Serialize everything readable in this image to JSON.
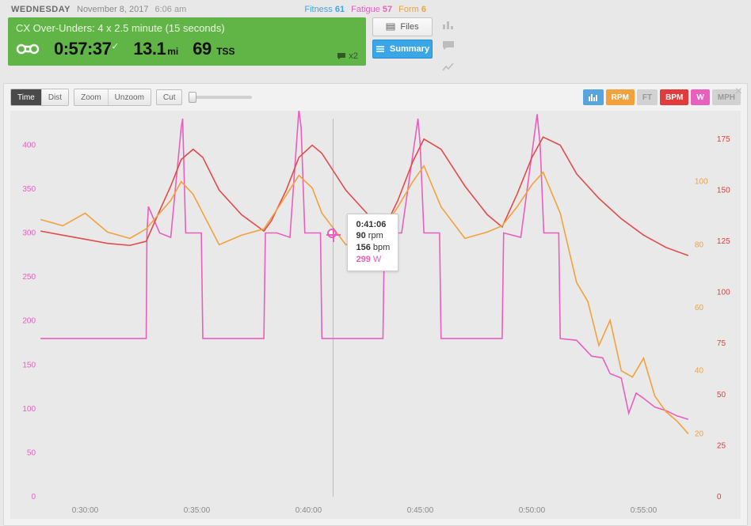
{
  "header": {
    "dow": "WEDNESDAY",
    "date": "November 8, 2017",
    "time": "6:06 am",
    "fitness_label": "Fitness",
    "fitness_value": "61",
    "fatigue_label": "Fatigue",
    "fatigue_value": "57",
    "form_label": "Form",
    "form_value": "6"
  },
  "workout": {
    "title": "CX Over-Unders: 4 x 2.5 minute (15 seconds)",
    "duration": "0:57:37",
    "distance_value": "13.1",
    "distance_unit": "mi",
    "tss_value": "69",
    "tss_label": "TSS",
    "comments_count": "x2"
  },
  "side": {
    "files": "Files",
    "summary": "Summary"
  },
  "toolbar": {
    "time": "Time",
    "dist": "Dist",
    "zoom": "Zoom",
    "unzoom": "Unzoom",
    "cut": "Cut"
  },
  "metrics": {
    "rpm": "RPM",
    "ft": "FT",
    "bpm": "BPM",
    "w": "W",
    "mph": "MPH"
  },
  "tooltip": {
    "time": "0:41:06",
    "rpm_value": "90",
    "rpm_unit": "rpm",
    "bpm_value": "156",
    "bpm_unit": "bpm",
    "w_value": "299",
    "w_unit": "W"
  },
  "chart_data": {
    "type": "line",
    "xlabel": "",
    "ylabel_left": "Watts",
    "ylabel_right1": "RPM",
    "ylabel_right2": "BPM",
    "x_ticks": [
      "0:30:00",
      "0:35:00",
      "0:40:00",
      "0:45:00",
      "0:50:00",
      "0:55:00"
    ],
    "y_left_ticks": [
      0,
      50,
      100,
      150,
      200,
      250,
      300,
      350,
      400
    ],
    "y_right_rpm_ticks": [
      20,
      40,
      60,
      80,
      100
    ],
    "y_right_bpm_ticks": [
      0,
      25,
      50,
      75,
      100,
      125,
      150,
      175
    ],
    "xlim_sec": [
      1680,
      3420
    ],
    "ylim_watts": [
      0,
      430
    ],
    "ylim_rpm": [
      0,
      120
    ],
    "ylim_bpm": [
      0,
      185
    ],
    "cursor_sec": 2466,
    "series": [
      {
        "name": "Watts",
        "unit": "W",
        "color": "#e95fbe",
        "points": [
          [
            1680,
            180
          ],
          [
            1740,
            180
          ],
          [
            1800,
            180
          ],
          [
            1860,
            180
          ],
          [
            1920,
            180
          ],
          [
            1964,
            180
          ],
          [
            1966,
            300
          ],
          [
            1970,
            330
          ],
          [
            2000,
            300
          ],
          [
            2030,
            295
          ],
          [
            2058,
            420
          ],
          [
            2062,
            430
          ],
          [
            2070,
            300
          ],
          [
            2112,
            300
          ],
          [
            2116,
            180
          ],
          [
            2160,
            180
          ],
          [
            2220,
            180
          ],
          [
            2280,
            180
          ],
          [
            2284,
            300
          ],
          [
            2315,
            300
          ],
          [
            2350,
            295
          ],
          [
            2374,
            440
          ],
          [
            2380,
            420
          ],
          [
            2390,
            300
          ],
          [
            2432,
            300
          ],
          [
            2436,
            180
          ],
          [
            2520,
            180
          ],
          [
            2580,
            180
          ],
          [
            2600,
            180
          ],
          [
            2604,
            300
          ],
          [
            2650,
            300
          ],
          [
            2694,
            430
          ],
          [
            2700,
            400
          ],
          [
            2710,
            300
          ],
          [
            2752,
            300
          ],
          [
            2756,
            180
          ],
          [
            2820,
            180
          ],
          [
            2880,
            180
          ],
          [
            2920,
            180
          ],
          [
            2924,
            300
          ],
          [
            2970,
            295
          ],
          [
            3014,
            435
          ],
          [
            3022,
            400
          ],
          [
            3032,
            300
          ],
          [
            3072,
            300
          ],
          [
            3076,
            180
          ],
          [
            3120,
            178
          ],
          [
            3160,
            160
          ],
          [
            3190,
            158
          ],
          [
            3210,
            140
          ],
          [
            3240,
            135
          ],
          [
            3260,
            95
          ],
          [
            3280,
            118
          ],
          [
            3300,
            112
          ],
          [
            3330,
            102
          ],
          [
            3360,
            98
          ],
          [
            3390,
            92
          ],
          [
            3420,
            88
          ]
        ]
      },
      {
        "name": "BPM",
        "unit": "bpm",
        "color": "#e24b4b",
        "points": [
          [
            1680,
            130
          ],
          [
            1740,
            128
          ],
          [
            1800,
            126
          ],
          [
            1860,
            124
          ],
          [
            1920,
            123
          ],
          [
            1964,
            125
          ],
          [
            2000,
            140
          ],
          [
            2030,
            152
          ],
          [
            2058,
            165
          ],
          [
            2090,
            170
          ],
          [
            2116,
            166
          ],
          [
            2160,
            150
          ],
          [
            2220,
            138
          ],
          [
            2280,
            130
          ],
          [
            2300,
            135
          ],
          [
            2340,
            150
          ],
          [
            2374,
            166
          ],
          [
            2410,
            172
          ],
          [
            2436,
            168
          ],
          [
            2500,
            150
          ],
          [
            2560,
            138
          ],
          [
            2600,
            130
          ],
          [
            2640,
            145
          ],
          [
            2680,
            164
          ],
          [
            2710,
            175
          ],
          [
            2756,
            170
          ],
          [
            2820,
            152
          ],
          [
            2880,
            138
          ],
          [
            2920,
            132
          ],
          [
            2960,
            148
          ],
          [
            3000,
            166
          ],
          [
            3030,
            176
          ],
          [
            3076,
            172
          ],
          [
            3120,
            158
          ],
          [
            3180,
            146
          ],
          [
            3240,
            136
          ],
          [
            3300,
            128
          ],
          [
            3360,
            122
          ],
          [
            3420,
            118
          ]
        ]
      },
      {
        "name": "RPM",
        "unit": "rpm",
        "color": "#f3a13a",
        "points": [
          [
            1680,
            88
          ],
          [
            1740,
            86
          ],
          [
            1800,
            90
          ],
          [
            1860,
            84
          ],
          [
            1920,
            82
          ],
          [
            1964,
            85
          ],
          [
            2000,
            90
          ],
          [
            2030,
            94
          ],
          [
            2058,
            100
          ],
          [
            2090,
            96
          ],
          [
            2116,
            90
          ],
          [
            2160,
            80
          ],
          [
            2220,
            83
          ],
          [
            2280,
            85
          ],
          [
            2320,
            92
          ],
          [
            2374,
            102
          ],
          [
            2410,
            98
          ],
          [
            2436,
            90
          ],
          [
            2500,
            80
          ],
          [
            2560,
            83
          ],
          [
            2600,
            85
          ],
          [
            2640,
            92
          ],
          [
            2680,
            100
          ],
          [
            2710,
            105
          ],
          [
            2756,
            92
          ],
          [
            2820,
            82
          ],
          [
            2880,
            84
          ],
          [
            2920,
            86
          ],
          [
            2960,
            92
          ],
          [
            3000,
            99
          ],
          [
            3030,
            103
          ],
          [
            3076,
            90
          ],
          [
            3120,
            68
          ],
          [
            3150,
            62
          ],
          [
            3180,
            48
          ],
          [
            3210,
            56
          ],
          [
            3240,
            40
          ],
          [
            3270,
            38
          ],
          [
            3300,
            44
          ],
          [
            3330,
            32
          ],
          [
            3360,
            27
          ],
          [
            3390,
            24
          ],
          [
            3420,
            20
          ]
        ]
      }
    ]
  }
}
